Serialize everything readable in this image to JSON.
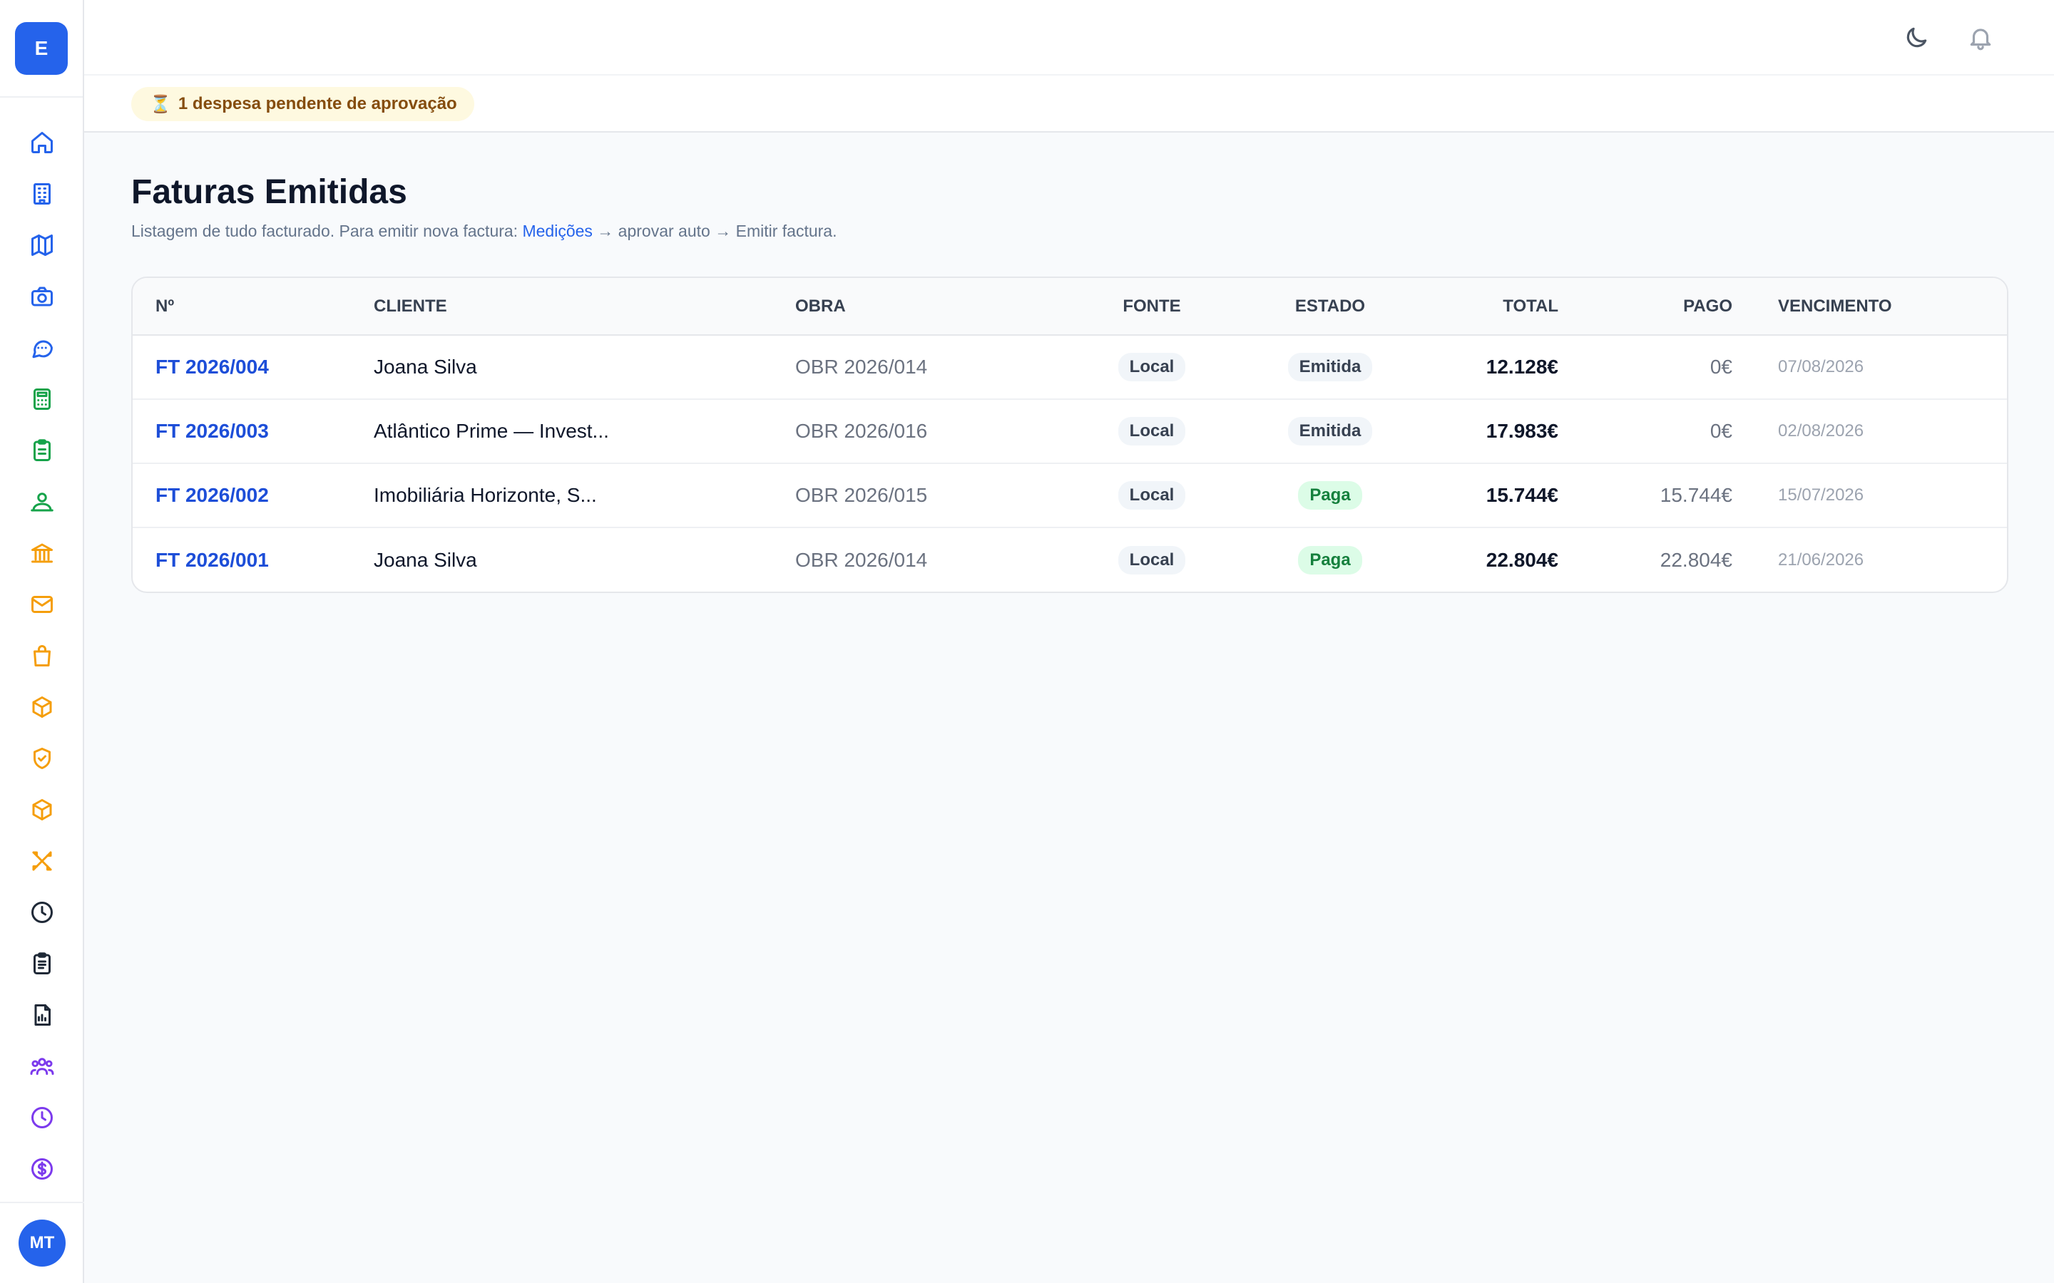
{
  "sidebar": {
    "logo": "E",
    "avatar": "MT",
    "icons": [
      {
        "name": "home-icon",
        "color": "#2563eb"
      },
      {
        "name": "building-icon",
        "color": "#2563eb"
      },
      {
        "name": "map-icon",
        "color": "#2563eb"
      },
      {
        "name": "camera-icon",
        "color": "#2563eb"
      },
      {
        "name": "chat-icon",
        "color": "#2563eb"
      },
      {
        "name": "calculator-icon",
        "color": "#16a34a"
      },
      {
        "name": "clipboard-icon",
        "color": "#16a34a"
      },
      {
        "name": "users-icon",
        "color": "#16a34a"
      },
      {
        "name": "bank-icon",
        "color": "#f59e0b"
      },
      {
        "name": "mail-icon",
        "color": "#f59e0b"
      },
      {
        "name": "shopping-bag-icon",
        "color": "#f59e0b"
      },
      {
        "name": "package-icon",
        "color": "#f59e0b"
      },
      {
        "name": "shield-check-icon",
        "color": "#f59e0b"
      },
      {
        "name": "box-icon",
        "color": "#f59e0b"
      },
      {
        "name": "tools-icon",
        "color": "#f59e0b"
      },
      {
        "name": "clock-icon",
        "color": "#1f2937"
      },
      {
        "name": "clipboard-list-icon",
        "color": "#1f2937"
      },
      {
        "name": "report-icon",
        "color": "#1f2937"
      },
      {
        "name": "team-icon",
        "color": "#7c3aed"
      },
      {
        "name": "history-icon",
        "color": "#7c3aed"
      },
      {
        "name": "dollar-icon",
        "color": "#7c3aed"
      }
    ]
  },
  "alert": {
    "icon": "⏳",
    "text": "1 despesa pendente de aprovação"
  },
  "page": {
    "title": "Faturas Emitidas",
    "subtitle_pre": "Listagem de tudo facturado. Para emitir nova factura: ",
    "subtitle_link": "Medições",
    "subtitle_post": " → aprovar auto → Emitir factura."
  },
  "table": {
    "headers": {
      "num": "Nº",
      "cliente": "CLIENTE",
      "obra": "OBRA",
      "fonte": "FONTE",
      "estado": "ESTADO",
      "total": "TOTAL",
      "pago": "PAGO",
      "vencimento": "VENCIMENTO"
    },
    "rows": [
      {
        "num": "FT 2026/004",
        "cliente": "Joana Silva",
        "obra": "OBR 2026/014",
        "fonte": "Local",
        "estado": "Emitida",
        "total": "12.128€",
        "pago": "0€",
        "vencimento": "07/08/2026"
      },
      {
        "num": "FT 2026/003",
        "cliente": "Atlântico Prime — Invest...",
        "obra": "OBR 2026/016",
        "fonte": "Local",
        "estado": "Emitida",
        "total": "17.983€",
        "pago": "0€",
        "vencimento": "02/08/2026"
      },
      {
        "num": "FT 2026/002",
        "cliente": "Imobiliária Horizonte, S...",
        "obra": "OBR 2026/015",
        "fonte": "Local",
        "estado": "Paga",
        "total": "15.744€",
        "pago": "15.744€",
        "vencimento": "15/07/2026"
      },
      {
        "num": "FT 2026/001",
        "cliente": "Joana Silva",
        "obra": "OBR 2026/014",
        "fonte": "Local",
        "estado": "Paga",
        "total": "22.804€",
        "pago": "22.804€",
        "vencimento": "21/06/2026"
      }
    ]
  }
}
